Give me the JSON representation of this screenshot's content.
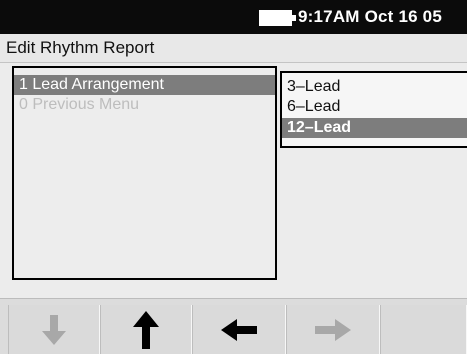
{
  "status_bar": {
    "time_text": "9:17AM Oct 16 05",
    "battery_icon": "battery-icon"
  },
  "title_bar": {
    "title": "Edit Rhythm Report"
  },
  "menu": {
    "items": [
      {
        "label": "1 Lead Arrangement",
        "state": "selected"
      },
      {
        "label": "0 Previous Menu",
        "state": "dimmed"
      }
    ]
  },
  "options": {
    "items": [
      {
        "label": "3–Lead",
        "state": "normal"
      },
      {
        "label": "6–Lead",
        "state": "normal"
      },
      {
        "label": "12–Lead",
        "state": "selected"
      }
    ]
  },
  "softkeys": [
    {
      "icon": "arrow-down-icon",
      "enabled": false
    },
    {
      "icon": "arrow-up-icon",
      "enabled": true
    },
    {
      "icon": "arrow-left-icon",
      "enabled": true
    },
    {
      "icon": "arrow-right-icon",
      "enabled": false
    },
    {
      "icon": "",
      "enabled": false
    }
  ],
  "colors": {
    "status_bar_bg": "#0b0b0b",
    "selection_bg": "#7d7d7d",
    "softkey_enabled": "#000000",
    "softkey_disabled": "#a8a8a8"
  }
}
